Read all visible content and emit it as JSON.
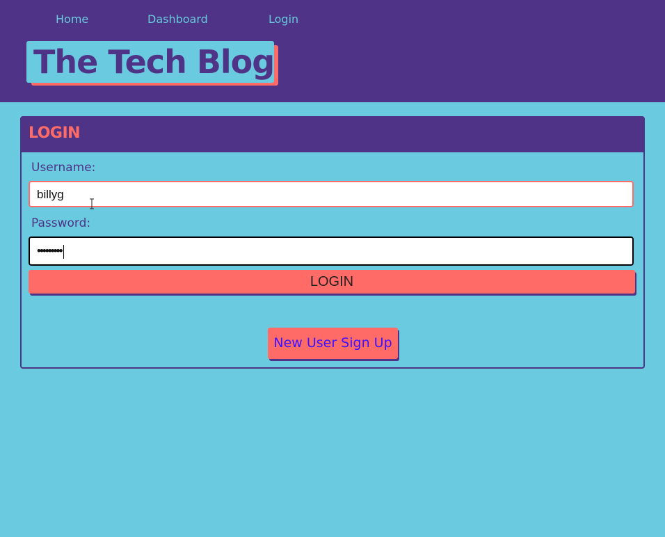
{
  "nav": {
    "home": "Home",
    "dashboard": "Dashboard",
    "login": "Login"
  },
  "site": {
    "title": "The Tech Blog"
  },
  "login_form": {
    "heading": "LOGIN",
    "username_label": "Username:",
    "username_value": "billyg",
    "password_label": "Password:",
    "password_masked": "•••••••••",
    "submit_label": "LOGIN",
    "signup_label": "New User Sign Up"
  },
  "colors": {
    "header_bg": "#4e3386",
    "page_bg": "#6acadf",
    "accent": "#ff6b66",
    "signup_text": "#3d12ff"
  },
  "icons": {
    "cursor": "text-cursor-icon"
  }
}
